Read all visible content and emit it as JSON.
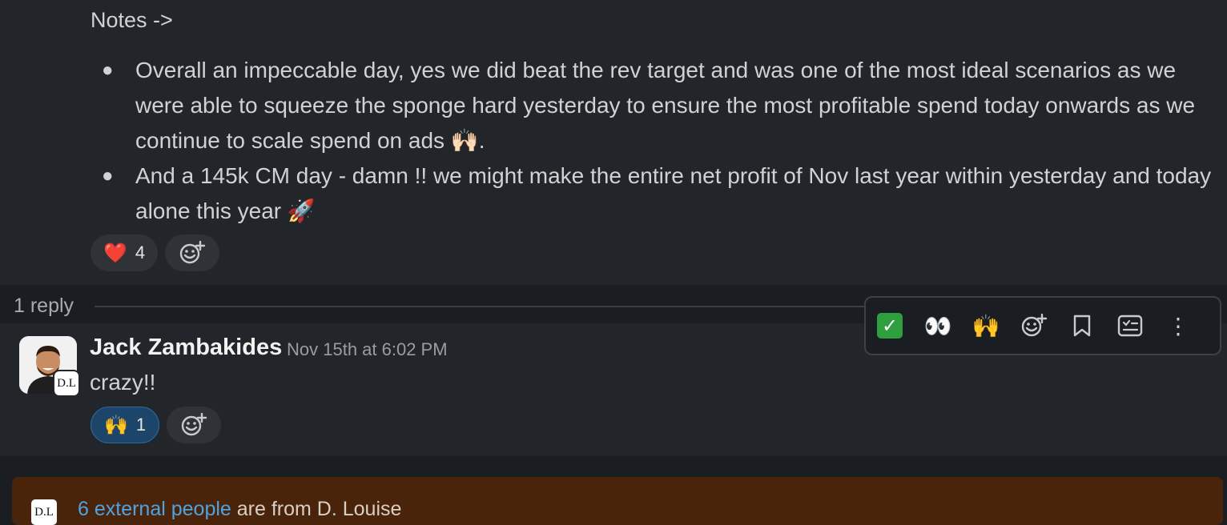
{
  "top_message": {
    "notes_title": "Notes ->",
    "bullets": [
      {
        "text": "Overall an impeccable day, yes we did beat the rev target and was one of the most ideal scenarios as we were able to squeeze the sponge hard yesterday to ensure the most profitable spend today onwards as we continue to scale spend on ads",
        "emoji": "🙌🏻",
        "suffix": "."
      },
      {
        "text": "And a 145k CM day - damn !! we might make the entire net profit of Nov last year within yesterday and today alone this year",
        "emoji": "🚀",
        "suffix": ""
      }
    ],
    "reactions": [
      {
        "emoji": "❤️",
        "count": "4"
      }
    ]
  },
  "thread": {
    "reply_count": "1 reply"
  },
  "reply_message": {
    "author": "Jack Zambakides",
    "timestamp": "Nov 15th at 6:02 PM",
    "text": "crazy!!",
    "avatar_badge": "D.L",
    "reactions": [
      {
        "emoji": "🙌",
        "count": "1"
      }
    ]
  },
  "hover_toolbar": {
    "icons": [
      "check-mark-icon",
      "eyes-icon",
      "raised-hands-icon",
      "add-reaction-icon",
      "bookmark-icon",
      "forward-icon",
      "more-icon"
    ],
    "eyes": "👀",
    "hands": "🙌",
    "more": "⋮"
  },
  "external_banner": {
    "logo": "D.L",
    "link_text": "6 external people",
    "text": " are from D. Louise"
  },
  "colors": {
    "background": "#1a1d21",
    "message_bg": "#222529",
    "link": "#4fa3e0",
    "banner_bg": "#4a230b",
    "active_reaction": "#1c4569"
  }
}
